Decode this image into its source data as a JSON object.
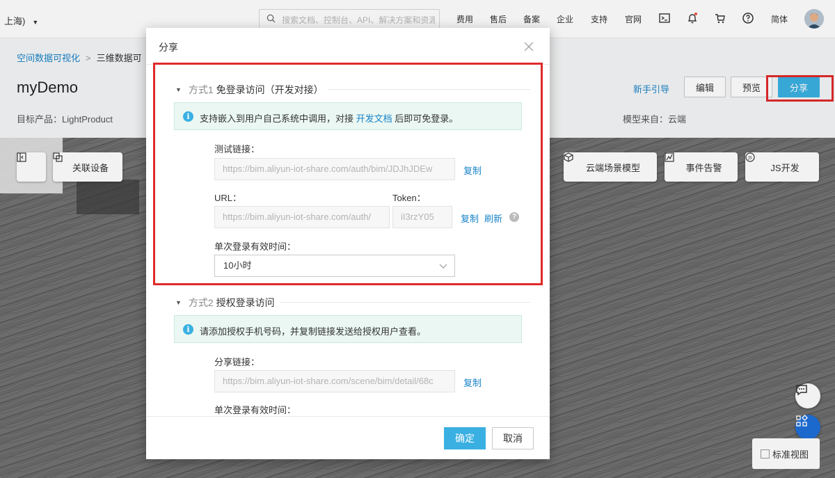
{
  "topbar": {
    "region": "上海)",
    "search_placeholder": "搜索文档、控制台、API、解决方案和资源",
    "links": [
      "费用",
      "售后",
      "备案",
      "企业",
      "支持",
      "官网"
    ],
    "lang": "简体"
  },
  "header": {
    "breadcrumb": [
      "空间数据可视化",
      "三维数据可"
    ],
    "title": "myDemo",
    "product": "目标产品：LightProduct",
    "model_source": "模型来自：云端",
    "guide": "新手引导",
    "edit": "编辑",
    "preview": "预览",
    "share": "分享"
  },
  "scene": {
    "link_device": "关联设备",
    "cloud_model": "云端场景模型",
    "event_alarm": "事件告警",
    "js_dev": "JS开发",
    "standard_view": "标准视图"
  },
  "modal": {
    "title": "分享",
    "method1_prefix": "方式1",
    "method1_title": "免登录访问（开发对接）",
    "method1_alert_pre": "支持嵌入到用户自己系统中调用，对接",
    "method1_alert_link": "开发文档",
    "method1_alert_post": "后即可免登录。",
    "test_link_label": "测试链接：",
    "test_link_value": "https://bim.aliyun-iot-share.com/auth/bim/JDJhJDEw",
    "copy": "复制",
    "url_label": "URL：",
    "url_value": "https://bim.aliyun-iot-share.com/auth/",
    "token_label": "Token：",
    "token_value": "iI3rzY05",
    "refresh": "刷新",
    "validity_label": "单次登录有效时间：",
    "validity_value": "10小时",
    "method2_prefix": "方式2",
    "method2_title": "授权登录访问",
    "method2_alert": "请添加授权手机号码，并复制链接发送给授权用户查看。",
    "share_link_label": "分享链接：",
    "share_link_value": "https://bim.aliyun-iot-share.com/scene/bim/detail/68c",
    "validity_label2": "单次登录有效时间：",
    "ok": "确定",
    "cancel": "取消"
  }
}
